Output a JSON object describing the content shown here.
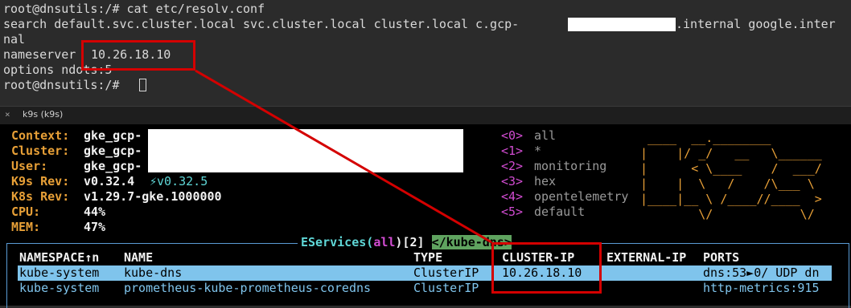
{
  "terminal": {
    "line1": "root@dnsutils:/# cat etc/resolv.conf",
    "line2a": "search default.svc.cluster.local svc.cluster.local cluster.local c.gcp-",
    "line2b": ".internal google.inter",
    "line3": "nal",
    "line4_label": "nameserver",
    "line4_value": "10.26.18.10",
    "line5": "options ndots:5",
    "line6": "root@dnsutils:/# "
  },
  "tab": {
    "close": "×",
    "title": "k9s (k9s)"
  },
  "k9s_info": {
    "context_label": "Context:",
    "context_value": "gke_gcp-",
    "cluster_label": "Cluster:",
    "cluster_value": "gke_gcp-",
    "user_label": "User:",
    "user_value": "gke_gcp-",
    "rev_label": "K9s Rev:",
    "rev_value": "v0.32.4",
    "rev_update": "⚡v0.32.5",
    "k8s_label": "K8s Rev:",
    "k8s_value": "v1.29.7-gke.1000000",
    "cpu_label": "CPU:",
    "cpu_value": "44%",
    "mem_label": "MEM:",
    "mem_value": "47%"
  },
  "hotkeys": [
    {
      "key": "<0>",
      "label": "all"
    },
    {
      "key": "<1>",
      "label": "*"
    },
    {
      "key": "<2>",
      "label": "monitoring"
    },
    {
      "key": "<3>",
      "label": "hex"
    },
    {
      "key": "<4>",
      "label": "opentelemetry"
    },
    {
      "key": "<5>",
      "label": "default"
    }
  ],
  "logo_lines": [
    " ____  __.________       ",
    "|    |/ _/   __   \\______",
    "|      < \\____    /  ___/",
    "|    |  \\   /    /\\___ \\ ",
    "|____|__ \\ /____//____  >",
    "        \\/            \\/ "
  ],
  "services": {
    "title_a": "EServices(",
    "title_b": "all",
    "title_c": ")[2]",
    "filter": "</kube-dns>",
    "columns": [
      "NAMESPACE↑n",
      "NAME",
      "TYPE",
      "CLUSTER-IP",
      "EXTERNAL-IP",
      "PORTS"
    ],
    "rows": [
      {
        "namespace": "kube-system",
        "name": "kube-dns",
        "type": "ClusterIP",
        "cluster_ip": "10.26.18.10",
        "external_ip": "",
        "ports": "dns:53►0/ UDP dn"
      },
      {
        "namespace": "kube-system",
        "name": "prometheus-kube-prometheus-coredns",
        "type": "ClusterIP",
        "cluster_ip": "",
        "external_ip": "",
        "ports": "http-metrics:915"
      }
    ]
  },
  "colors": {
    "accent_orange": "#e8a037",
    "accent_cyan": "#5fd7d7",
    "hotkey_magenta": "#d24cd2",
    "highlight_red": "#d40000",
    "selected_row": "#7fc4ec"
  }
}
